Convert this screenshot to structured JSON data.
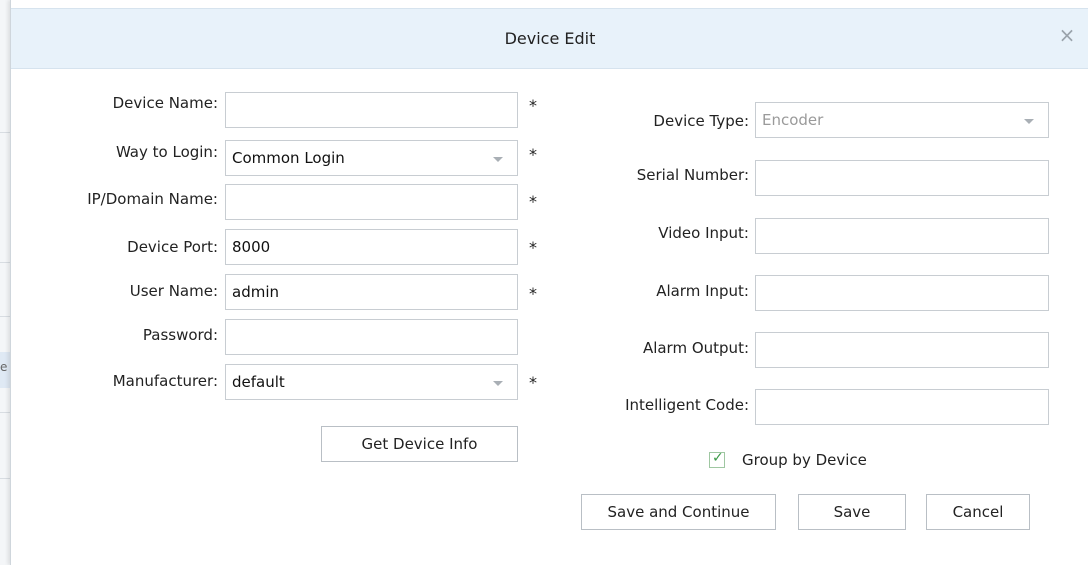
{
  "dialog": {
    "title": "Device Edit",
    "close_glyph": "×"
  },
  "background": {
    "partial_char": "e"
  },
  "left_form": {
    "device_name": {
      "label": "Device Name:",
      "value": "",
      "required": "*"
    },
    "way_to_login": {
      "label": "Way to Login:",
      "value": "Common Login",
      "required": "*"
    },
    "ip_domain": {
      "label": "IP/Domain Name:",
      "value": "",
      "required": "*"
    },
    "device_port": {
      "label": "Device Port:",
      "value": "8000",
      "required": "*"
    },
    "user_name": {
      "label": "User Name:",
      "value": "admin",
      "required": "*"
    },
    "password": {
      "label": "Password:",
      "value": ""
    },
    "manufacturer": {
      "label": "Manufacturer:",
      "value": "default",
      "required": "*"
    },
    "get_device_info_label": "Get Device Info"
  },
  "right_form": {
    "device_type": {
      "label": "Device Type:",
      "value": "Encoder"
    },
    "serial_number": {
      "label": "Serial Number:",
      "value": ""
    },
    "video_input": {
      "label": "Video Input:",
      "value": ""
    },
    "alarm_input": {
      "label": "Alarm Input:",
      "value": ""
    },
    "alarm_output": {
      "label": "Alarm Output:",
      "value": ""
    },
    "intelligent_code": {
      "label": "Intelligent Code:",
      "value": ""
    },
    "group_by_device": {
      "label": "Group by Device",
      "checked": true,
      "check_glyph": "✓"
    }
  },
  "footer": {
    "save_continue_label": "Save and Continue",
    "save_label": "Save",
    "cancel_label": "Cancel"
  },
  "colors": {
    "titlebar_bg": "#e8f2fa",
    "border": "#c8cdd2",
    "check_green": "#3a9a47"
  },
  "icons": {
    "close": "close-icon",
    "dropdown": "chevron-down-icon",
    "check": "check-icon"
  }
}
